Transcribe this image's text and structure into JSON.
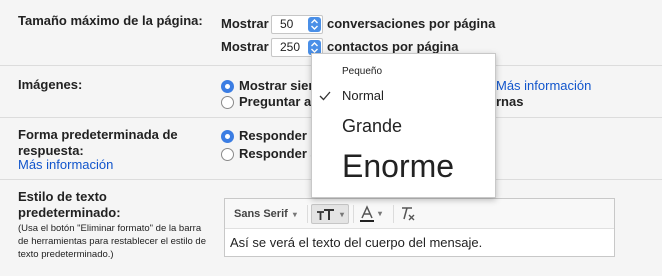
{
  "page_size": {
    "label": "Tamaño máximo de la página:",
    "prefix": "Mostrar",
    "conversations_value": "50",
    "conversations_suffix": "conversaciones por página",
    "contacts_value": "250",
    "contacts_suffix": "contactos por página"
  },
  "images": {
    "label": "Imágenes:",
    "option1": "Mostrar sier",
    "option2": "Preguntar ar",
    "more_info": "Más información",
    "option2_tail": "rnas"
  },
  "reply": {
    "label": "Forma predeterminada de respuesta:",
    "more_info": "Más información",
    "option1": "Responder",
    "option2": "Responder a"
  },
  "text_style": {
    "label": "Estilo de texto predeterminado:",
    "note": "(Usa el botón \"Eliminar formato\" de la barra de herramientas para restablecer el estilo de texto predeterminado.)",
    "font": "Sans Serif",
    "sample": "Así se verá el texto del cuerpo del mensaje."
  },
  "size_menu": {
    "options": [
      "Pequeño",
      "Normal",
      "Grande",
      "Enorme"
    ],
    "selected": "Normal"
  },
  "colors": {
    "accent": "#3b7de3",
    "link": "#1155cc"
  }
}
